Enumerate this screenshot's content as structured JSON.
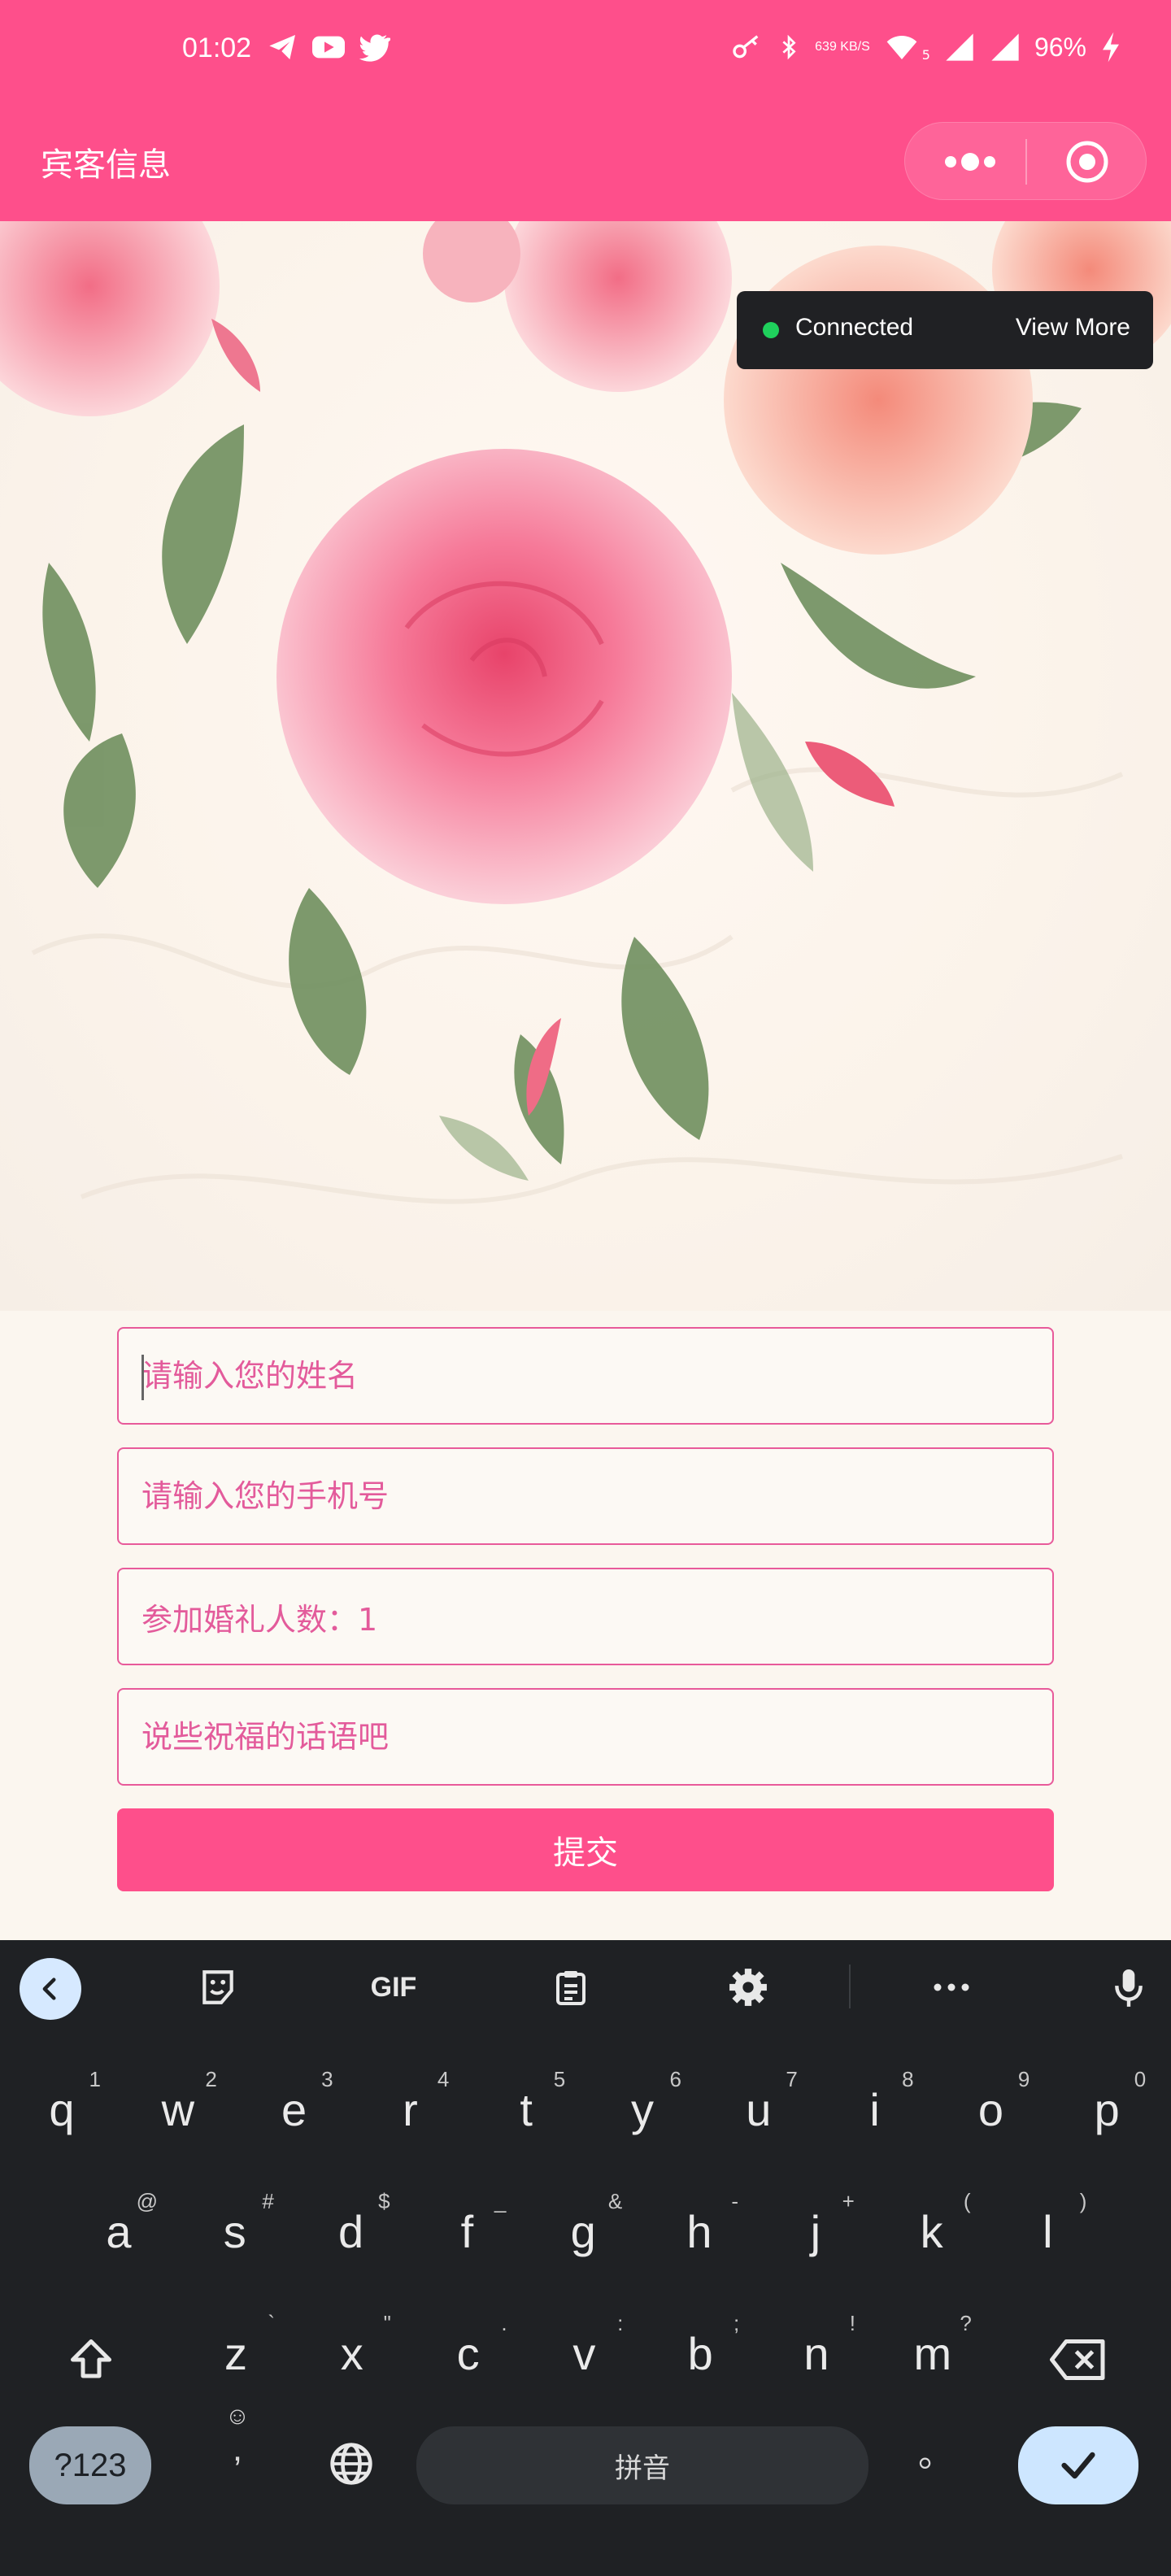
{
  "status_bar": {
    "time": "01:02",
    "network_speed": "639 KB/S",
    "network_type": "5",
    "battery": "96%",
    "icons_left": [
      "telegram-icon",
      "youtube-icon",
      "twitter-icon"
    ],
    "icons_right": [
      "key-icon",
      "bluetooth-icon",
      "wifi-icon",
      "signal-icon",
      "signal-icon",
      "charging-icon"
    ]
  },
  "app": {
    "title": "宾客信息",
    "accent": "#fe4f8b"
  },
  "toast": {
    "label": "Connected",
    "action": "View More"
  },
  "form": {
    "name_placeholder": "请输入您的姓名",
    "phone_placeholder": "请输入您的手机号",
    "guests_value": "参加婚礼人数：1",
    "blessing_placeholder": "说些祝福的话语吧",
    "submit_label": "提交"
  },
  "keyboard": {
    "toolbar": {
      "gif": "GIF"
    },
    "row1": [
      {
        "k": "q",
        "s": "1"
      },
      {
        "k": "w",
        "s": "2"
      },
      {
        "k": "e",
        "s": "3"
      },
      {
        "k": "r",
        "s": "4"
      },
      {
        "k": "t",
        "s": "5"
      },
      {
        "k": "y",
        "s": "6"
      },
      {
        "k": "u",
        "s": "7"
      },
      {
        "k": "i",
        "s": "8"
      },
      {
        "k": "o",
        "s": "9"
      },
      {
        "k": "p",
        "s": "0"
      }
    ],
    "row2": [
      {
        "k": "a",
        "s": "@"
      },
      {
        "k": "s",
        "s": "#"
      },
      {
        "k": "d",
        "s": "$"
      },
      {
        "k": "f",
        "s": "_"
      },
      {
        "k": "g",
        "s": "&"
      },
      {
        "k": "h",
        "s": "-"
      },
      {
        "k": "j",
        "s": "+"
      },
      {
        "k": "k",
        "s": "("
      },
      {
        "k": "l",
        "s": ")"
      }
    ],
    "row3": [
      {
        "k": "z",
        "s": "`"
      },
      {
        "k": "x",
        "s": "\""
      },
      {
        "k": "c",
        "s": "."
      },
      {
        "k": "v",
        "s": ":"
      },
      {
        "k": "b",
        "s": ";"
      },
      {
        "k": "n",
        "s": "!"
      },
      {
        "k": "m",
        "s": "?"
      }
    ],
    "symbols_label": "?123",
    "comma_label": ",",
    "space_label": "拼音",
    "period_label": "。"
  }
}
